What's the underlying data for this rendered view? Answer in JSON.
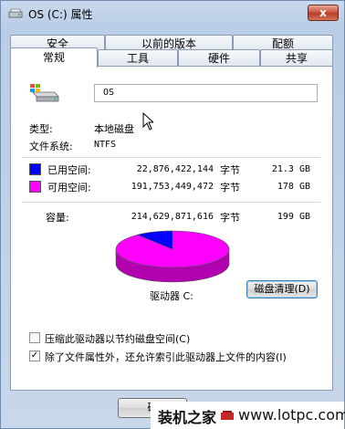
{
  "window": {
    "title": "OS (C:) 属性",
    "close_label": "x"
  },
  "tabs_back": [
    "安全",
    "以前的版本",
    "配额"
  ],
  "tabs_front": [
    "常规",
    "工具",
    "硬件",
    "共享"
  ],
  "general": {
    "drive_name": "OS",
    "type_label": "类型:",
    "type_value": "本地磁盘",
    "fs_label": "文件系统:",
    "fs_value": "NTFS",
    "used": {
      "label": "已用空间:",
      "bytes": "22,876,422,144",
      "unit": "字节",
      "size": "21.3 GB",
      "color": "#0000ff",
      "bytes_value": 22876422144
    },
    "free": {
      "label": "可用空间:",
      "bytes": "191,753,449,472",
      "unit": "字节",
      "size": "178 GB",
      "color": "#ff00ff",
      "bytes_value": 191753449472
    },
    "capacity": {
      "label": "容量:",
      "bytes": "214,629,871,616",
      "unit": "字节",
      "size": "199 GB"
    },
    "drive_label": "驱动器 C:",
    "cleanup_button": "磁盘清理(D)",
    "compress_checkbox": {
      "label": "压缩此驱动器以节约磁盘空间(C)",
      "checked": false
    },
    "index_checkbox": {
      "label": "除了文件属性外，还允许索引此驱动器上文件的内容(I)",
      "checked": true
    }
  },
  "footer": {
    "ok_partial": "确"
  },
  "watermark": {
    "site_name": "装机之家",
    "url": "www.lotpc.com"
  }
}
